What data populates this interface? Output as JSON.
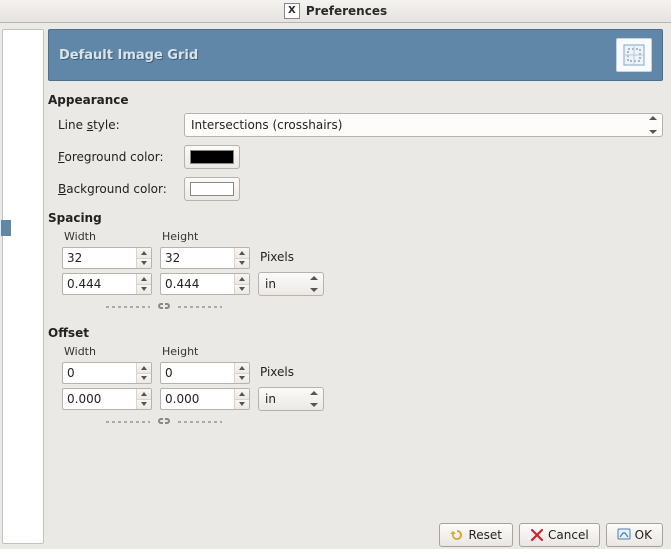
{
  "window": {
    "title": "Preferences",
    "app_icon_letter": "X"
  },
  "banner": {
    "title": "Default Image Grid"
  },
  "appearance": {
    "heading": "Appearance",
    "line_style_label": "Line style:",
    "line_style_value": "Intersections (crosshairs)",
    "foreground_label": "Foreground color:",
    "background_label": "Background color:",
    "foreground_color": "#000000",
    "background_color": "#ffffff"
  },
  "spacing": {
    "heading": "Spacing",
    "width_label": "Width",
    "height_label": "Height",
    "width_px": "32",
    "height_px": "32",
    "pixels_label": "Pixels",
    "width_unit": "0.444",
    "height_unit": "0.444",
    "unit": "in"
  },
  "offset": {
    "heading": "Offset",
    "width_label": "Width",
    "height_label": "Height",
    "width_px": "0",
    "height_px": "0",
    "pixels_label": "Pixels",
    "width_unit": "0.000",
    "height_unit": "0.000",
    "unit": "in"
  },
  "buttons": {
    "reset": "Reset",
    "cancel": "Cancel",
    "ok": "OK"
  },
  "icons": {
    "grid": "grid",
    "chain": "chain",
    "reset": "reset-yellow",
    "cancel": "red-x",
    "ok": "blue-apply"
  }
}
